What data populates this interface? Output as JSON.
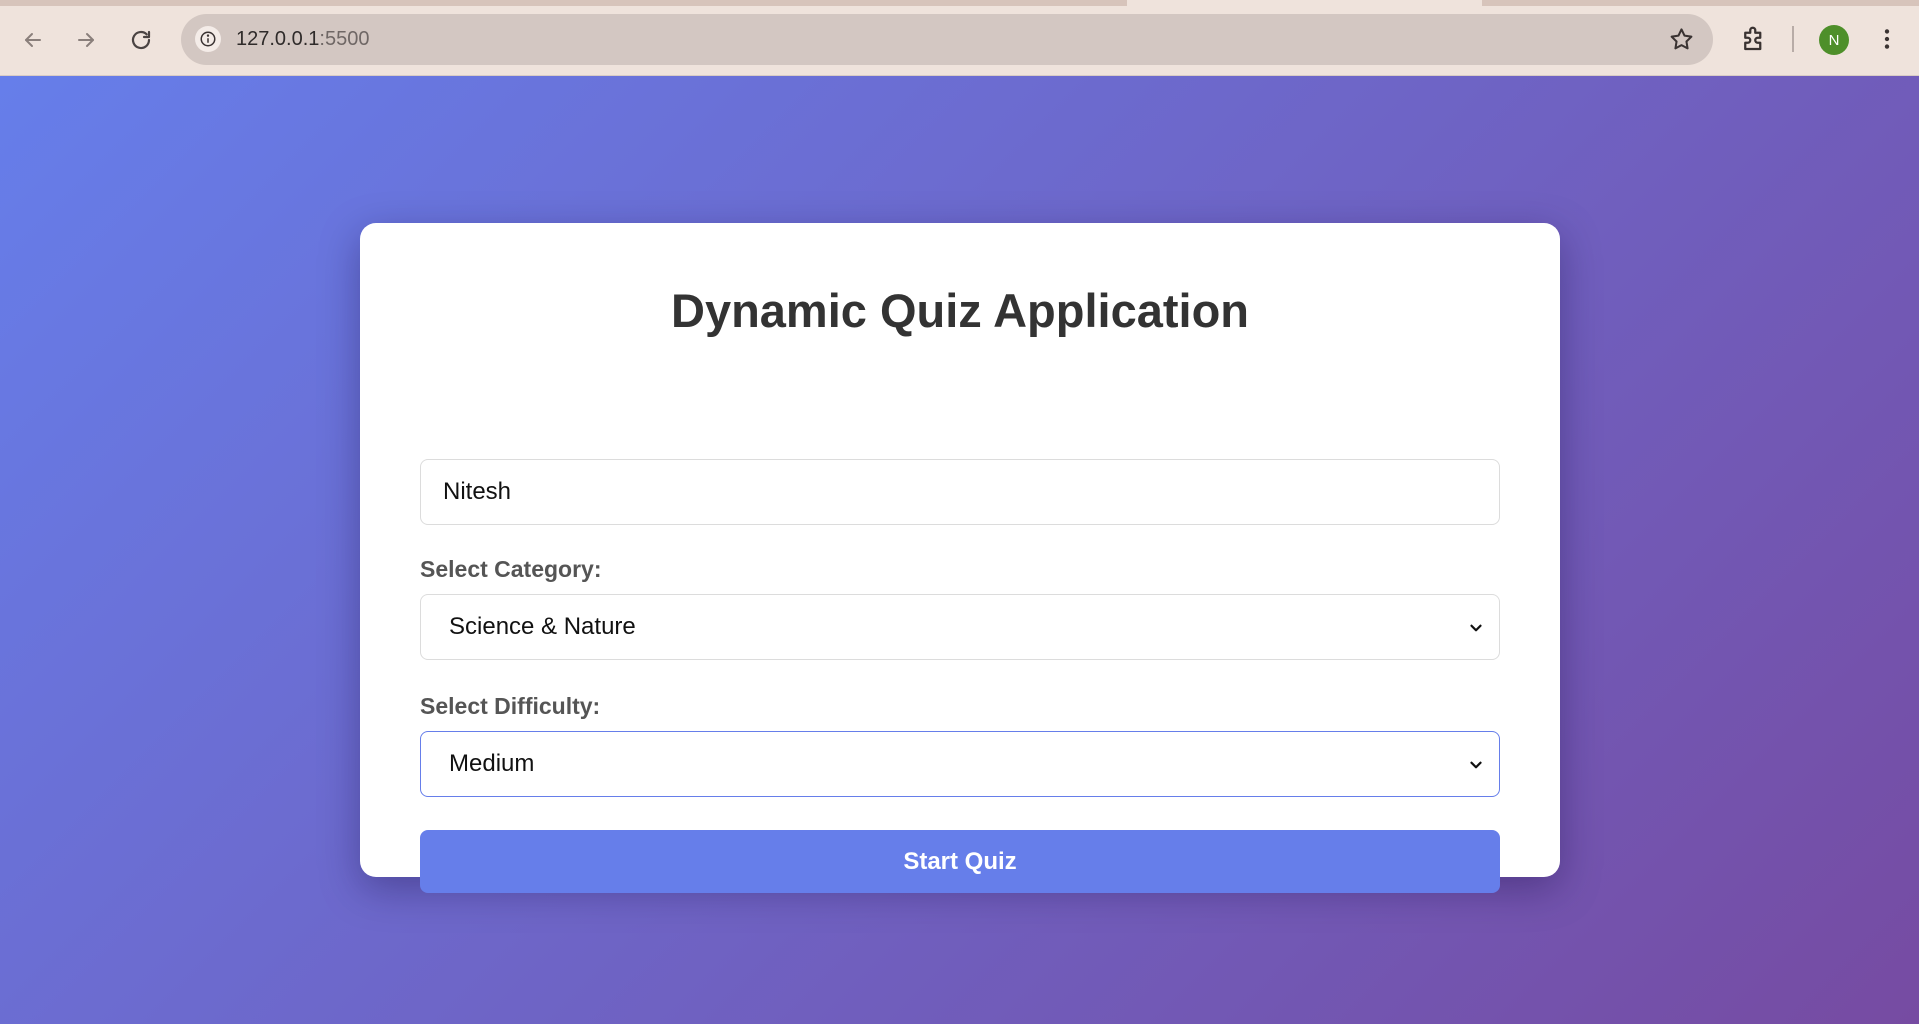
{
  "browser": {
    "url_host": "127.0.0.1",
    "url_port": ":5500",
    "profile_initial": "N",
    "icons": [
      "back-arrow-icon",
      "forward-arrow-icon",
      "reload-icon",
      "site-info-icon",
      "bookmark-star-icon",
      "extensions-puzzle-icon",
      "kebab-menu-icon"
    ]
  },
  "quiz": {
    "title": "Dynamic Quiz Application",
    "name_value": "Nitesh",
    "category_label": "Select Category:",
    "category_value": "Science & Nature",
    "difficulty_label": "Select Difficulty:",
    "difficulty_value": "Medium",
    "start_label": "Start Quiz"
  },
  "colors": {
    "gradient_start": "#667eea",
    "gradient_end": "#764ba2",
    "button": "#667eea",
    "avatar": "#4e8f2a"
  }
}
